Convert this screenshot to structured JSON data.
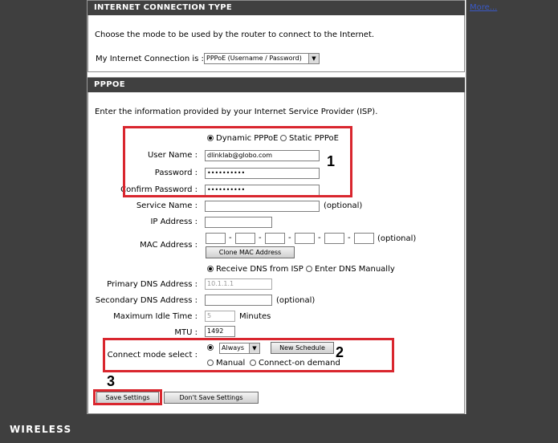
{
  "more_link": "More...",
  "internet_connection_type": {
    "title": "INTERNET CONNECTION TYPE",
    "description": "Choose the mode to be used by the router to connect to the Internet.",
    "label": "My Internet Connection is :",
    "selected": "PPPoE (Username / Password)"
  },
  "pppoe": {
    "title": "PPPOE",
    "description": "Enter the information provided by your Internet Service Provider (ISP).",
    "dynamic_label": "Dynamic PPPoE",
    "static_label": "Static PPPoE",
    "username_label": "User Name :",
    "username_value": "dlinklab@globo.com",
    "password_label": "Password :",
    "password_value": "••••••••••",
    "confirm_label": "Confirm Password :",
    "confirm_value": "••••••••••",
    "service_label": "Service Name :",
    "optional": "(optional)",
    "ip_label": "IP Address :",
    "mac_label": "MAC Address :",
    "mac_optional": "(optional)",
    "mac_sep": "-",
    "clone_mac": "Clone MAC Address",
    "receive_dns": "Receive DNS from ISP",
    "enter_dns": "Enter DNS Manually",
    "primary_dns_label": "Primary DNS Address :",
    "primary_dns_value": "10.1.1.1",
    "secondary_dns_label": "Secondary DNS Address :",
    "secondary_optional": "(optional)",
    "idle_label": "Maximum Idle Time :",
    "idle_value": "5",
    "idle_unit": "Minutes",
    "mtu_label": "MTU :",
    "mtu_value": "1492",
    "connect_label": "Connect mode select :",
    "schedule_value": "Always",
    "new_schedule": "New Schedule",
    "manual": "Manual",
    "on_demand": "Connect-on demand"
  },
  "buttons": {
    "save": "Save Settings",
    "dont_save": "Don't Save Settings"
  },
  "annotations": {
    "one": "1",
    "two": "2",
    "three": "3"
  },
  "footer": {
    "brand": "WIRELESS"
  },
  "colors": {
    "highlight": "#d9262e",
    "header": "#404040",
    "link": "#3a59c7"
  }
}
